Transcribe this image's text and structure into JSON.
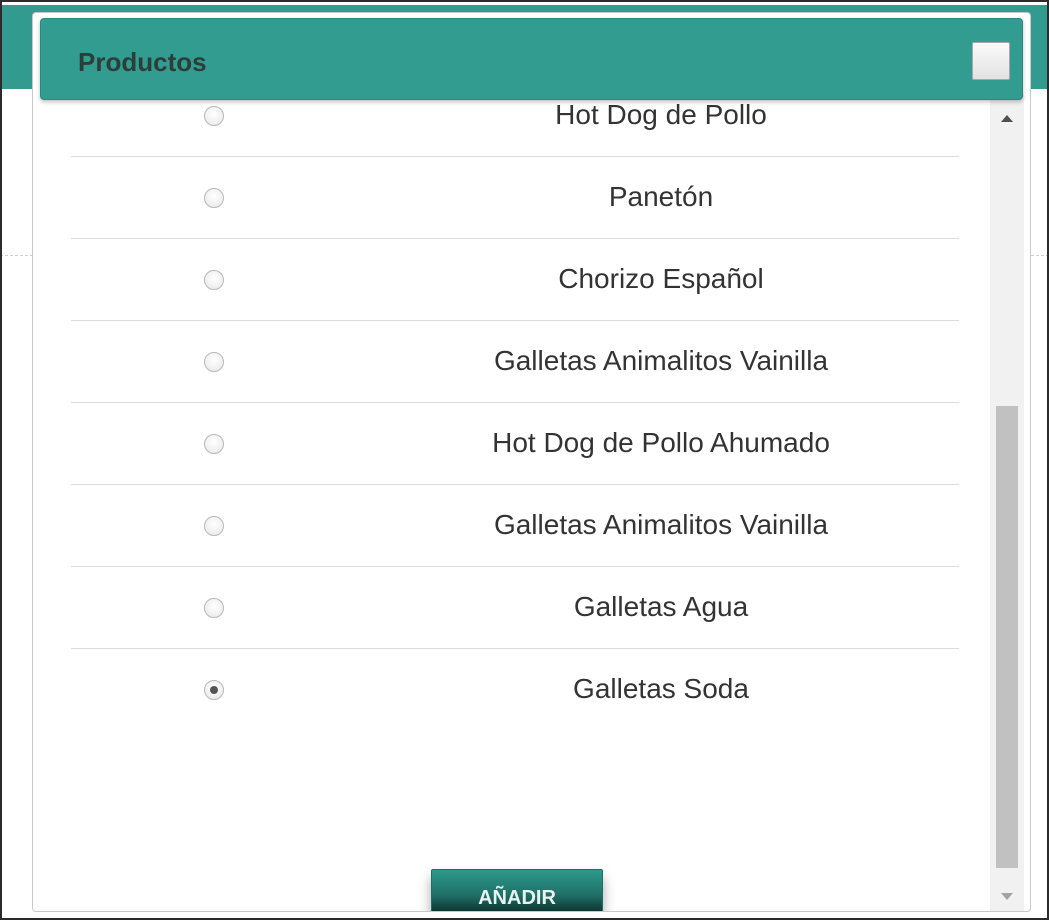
{
  "dialog": {
    "title": "Productos"
  },
  "products": [
    {
      "label": "Hot Dog de Pollo",
      "selected": false
    },
    {
      "label": "Panetón",
      "selected": false
    },
    {
      "label": "Chorizo Español",
      "selected": false
    },
    {
      "label": "Galletas Animalitos Vainilla",
      "selected": false
    },
    {
      "label": "Hot Dog de Pollo Ahumado",
      "selected": false
    },
    {
      "label": "Galletas Animalitos Vainilla",
      "selected": false
    },
    {
      "label": "Galletas Agua",
      "selected": false
    },
    {
      "label": "Galletas Soda",
      "selected": true
    }
  ],
  "actions": {
    "add_label": "AÑADIR"
  },
  "colors": {
    "header_teal": "#339c90",
    "button_dark": "#0b2a27",
    "text": "#333333"
  }
}
